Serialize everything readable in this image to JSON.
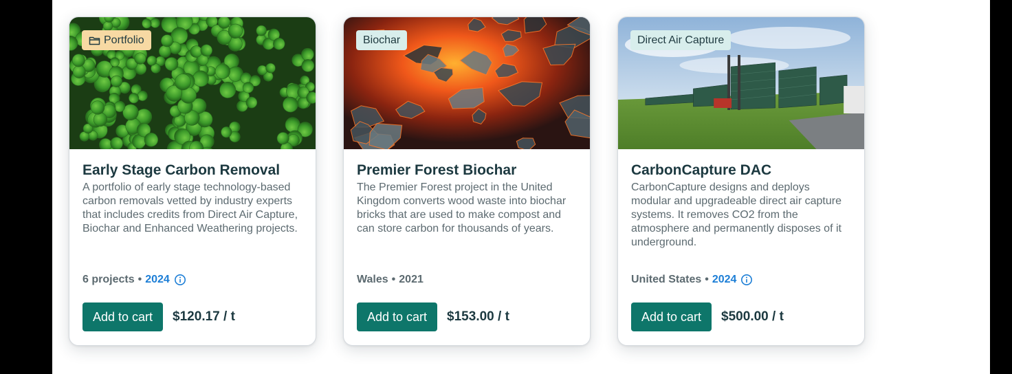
{
  "cards": [
    {
      "tag": "Portfolio",
      "tag_icon": "folder-icon",
      "title": "Early Stage Carbon Removal",
      "description": "A portfolio of early stage technology-based carbon removals vetted by industry experts that includes credits from Direct Air Capture, Biochar and Enhanced Weathering projects.",
      "meta_text": "6 projects",
      "meta_sep": "•",
      "year": "2024",
      "year_highlight": true,
      "button_label": "Add to cart",
      "price": "$120.17 / t",
      "image": "clover-field"
    },
    {
      "tag": "Biochar",
      "title": "Premier Forest Biochar",
      "description": "The Premier Forest project in the United Kingdom converts wood waste into biochar bricks that are used to make compost and can store carbon for thousands of years.",
      "meta_text": "Wales",
      "meta_sep": "•",
      "year": "2021",
      "year_highlight": false,
      "button_label": "Add to cart",
      "price": "$153.00 / t",
      "image": "glowing-embers"
    },
    {
      "tag": "Direct Air Capture",
      "title": "CarbonCapture DAC",
      "description": "CarbonCapture designs and deploys modular and upgradeable direct air capture systems. It removes CO2 from the atmosphere and permanently disposes of it underground.",
      "meta_text": "United States",
      "meta_sep": "•",
      "year": "2024",
      "year_highlight": true,
      "button_label": "Add to cart",
      "price": "$500.00 / t",
      "image": "dac-facility"
    }
  ],
  "colors": {
    "primary_button": "#0e766a",
    "title_text": "#1c3940",
    "body_text": "#5c6a70",
    "year_link": "#1c7ed6",
    "tag_orange": "#f7d9a3",
    "tag_mint": "#d8eeec"
  }
}
